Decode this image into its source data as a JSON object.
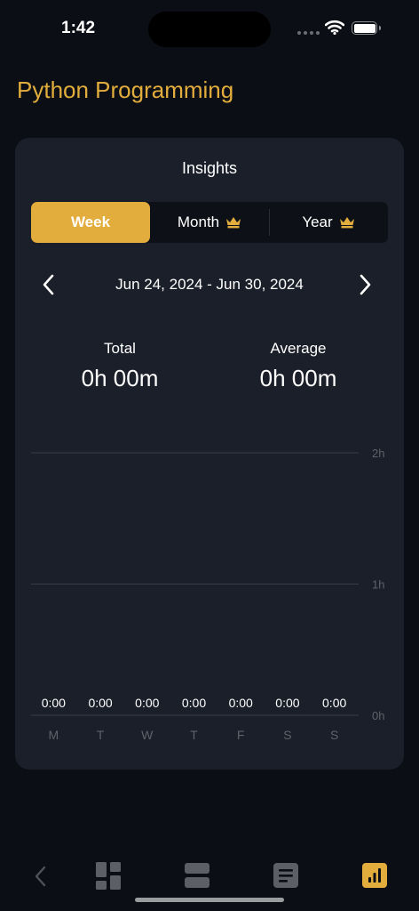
{
  "status": {
    "time": "1:42"
  },
  "page": {
    "title": "Python Programming"
  },
  "insights": {
    "title": "Insights",
    "tabs": [
      {
        "label": "Week",
        "selected": true,
        "premium": false
      },
      {
        "label": "Month",
        "selected": false,
        "premium": true
      },
      {
        "label": "Year",
        "selected": false,
        "premium": true
      }
    ],
    "date_range": "Jun 24, 2024 - Jun 30, 2024",
    "total": {
      "label": "Total",
      "value": "0h 00m"
    },
    "average": {
      "label": "Average",
      "value": "0h 00m"
    }
  },
  "chart_data": {
    "type": "bar",
    "categories": [
      "M",
      "T",
      "W",
      "T",
      "F",
      "S",
      "S"
    ],
    "values": [
      0,
      0,
      0,
      0,
      0,
      0,
      0
    ],
    "data_labels": [
      "0:00",
      "0:00",
      "0:00",
      "0:00",
      "0:00",
      "0:00",
      "0:00"
    ],
    "y_ticks": [
      {
        "value": 0,
        "label": "0h"
      },
      {
        "value": 1,
        "label": "1h"
      },
      {
        "value": 2,
        "label": "2h"
      }
    ],
    "ylim": [
      0,
      2
    ],
    "grid": true,
    "colors": {
      "bar": "#e2ad3c",
      "grid": "#3a3d44",
      "tick_label": "#5f626a",
      "data_label": "#ffffff"
    }
  },
  "tabbar": {
    "items": [
      {
        "icon": "back-chevron-icon",
        "active": false
      },
      {
        "icon": "dashboard-icon",
        "active": false
      },
      {
        "icon": "sections-icon",
        "active": false
      },
      {
        "icon": "notes-icon",
        "active": false
      },
      {
        "icon": "insights-chart-icon",
        "active": true
      }
    ]
  },
  "colors": {
    "accent": "#e2ad3c",
    "background": "#0b0e14",
    "card": "#1b1f29",
    "segment_bg": "#0d1016"
  }
}
